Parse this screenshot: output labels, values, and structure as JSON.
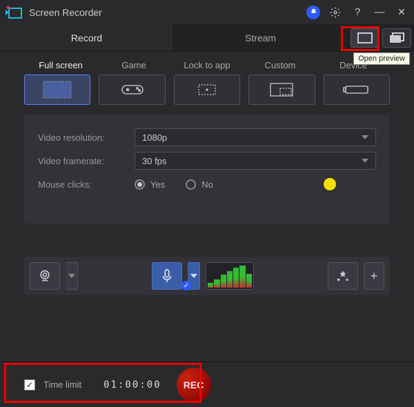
{
  "app": {
    "title": "Screen Recorder"
  },
  "titlebar_icons": {
    "min": "—",
    "close": "✕",
    "help": "?"
  },
  "tooltip": "Open preview",
  "tabs": {
    "record": "Record",
    "stream": "Stream"
  },
  "modes": [
    "Full screen",
    "Game",
    "Lock to app",
    "Custom",
    "Device"
  ],
  "settings": {
    "resolution_label": "Video resolution:",
    "resolution_value": "1080p",
    "framerate_label": "Video framerate:",
    "framerate_value": "30 fps",
    "mouse_label": "Mouse clicks:",
    "yes": "Yes",
    "no": "No",
    "click_color": "#f5e000"
  },
  "bottom": {
    "time_limit_label": "Time limit",
    "time_limit_value": "01:00:00",
    "time_limit_checked": true,
    "rec": "REC"
  }
}
